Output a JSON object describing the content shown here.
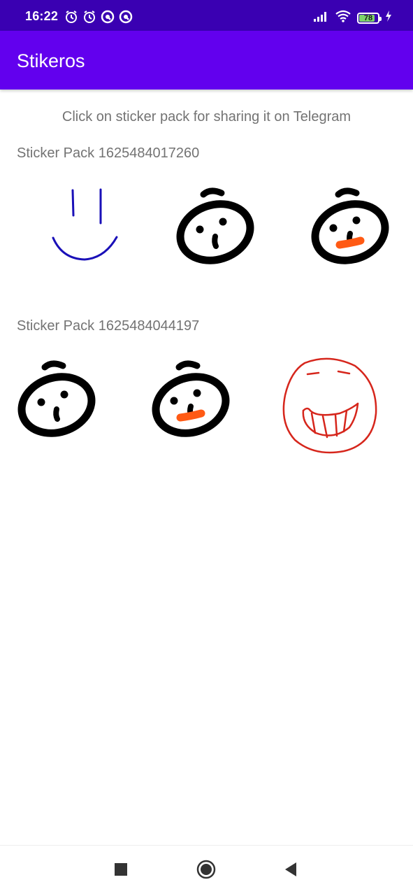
{
  "status_bar": {
    "time": "16:22",
    "battery_level": "78",
    "icons": [
      "alarm-icon",
      "alarm-icon",
      "app-notification-icon",
      "app-notification-icon",
      "signal-icon",
      "wifi-icon",
      "battery-icon",
      "charging-icon"
    ]
  },
  "app_bar": {
    "title": "Stikeros"
  },
  "hint": "Click on sticker pack for sharing it on Telegram",
  "packs": [
    {
      "title": "Sticker Pack 1625484017260",
      "stickers": [
        "smile-sticker-blue",
        "face-sticker-black",
        "face-sticker-black-orange-mouth"
      ]
    },
    {
      "title": "Sticker Pack 1625484044197",
      "stickers": [
        "face-sticker-black",
        "face-sticker-black-orange-mouth",
        "grin-sticker-red"
      ]
    }
  ],
  "colors": {
    "status_bar": "#3a00b2",
    "app_bar": "#6200ee",
    "text_secondary": "#737373",
    "sticker_blue": "#1a10b8",
    "sticker_orange": "#ff5a14",
    "sticker_red": "#d6261c"
  },
  "nav_bar": {
    "buttons": [
      "recents-icon",
      "home-icon",
      "back-icon"
    ]
  }
}
